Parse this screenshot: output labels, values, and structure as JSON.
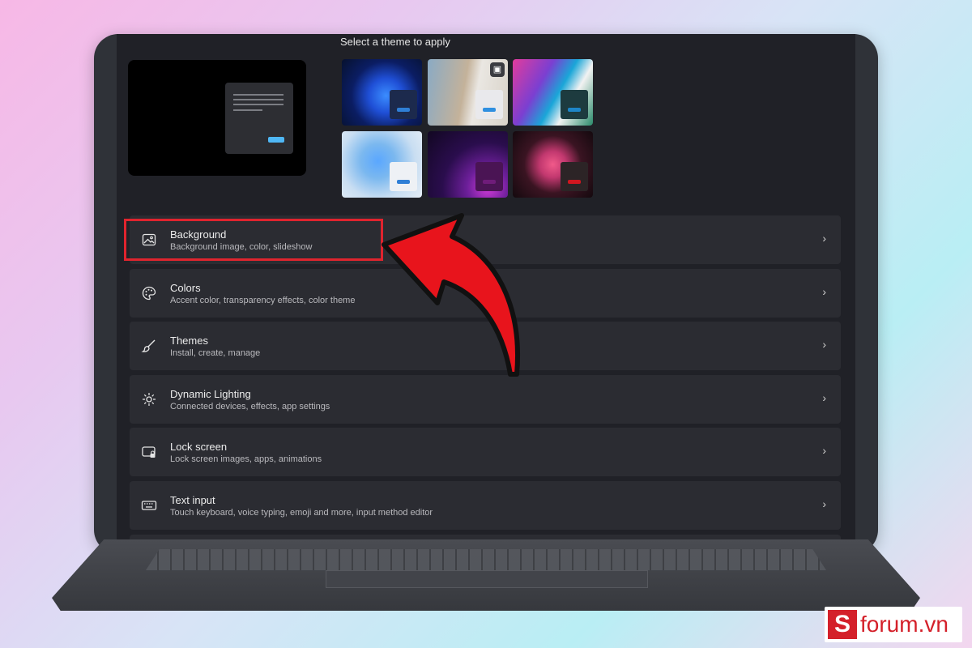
{
  "theme_section": {
    "title": "Select a theme to apply",
    "themes": [
      {
        "name": "blue-bloom-dark",
        "accent": "#2f7fd6"
      },
      {
        "name": "glow-photo",
        "accent": "#2f8fe0"
      },
      {
        "name": "captured-motion",
        "accent": "#1e86c8"
      },
      {
        "name": "blue-bloom-light",
        "accent": "#2f7fd6"
      },
      {
        "name": "flow-purple",
        "accent": "#6f1c7a"
      },
      {
        "name": "sunrise-flower",
        "accent": "#d0161f"
      }
    ]
  },
  "settings_rows": [
    {
      "label": "Background",
      "desc": "Background image, color, slideshow",
      "icon": "image-icon"
    },
    {
      "label": "Colors",
      "desc": "Accent color, transparency effects, color theme",
      "icon": "palette-icon"
    },
    {
      "label": "Themes",
      "desc": "Install, create, manage",
      "icon": "brush-icon"
    },
    {
      "label": "Dynamic Lighting",
      "desc": "Connected devices, effects, app settings",
      "icon": "lighting-icon"
    },
    {
      "label": "Lock screen",
      "desc": "Lock screen images, apps, animations",
      "icon": "lock-screen-icon"
    },
    {
      "label": "Text input",
      "desc": "Touch keyboard, voice typing, emoji and more, input method editor",
      "icon": "keyboard-icon"
    }
  ],
  "annotation": {
    "highlight_color": "#e0242e"
  },
  "brand": {
    "mark": "S",
    "text": "forum.vn"
  }
}
